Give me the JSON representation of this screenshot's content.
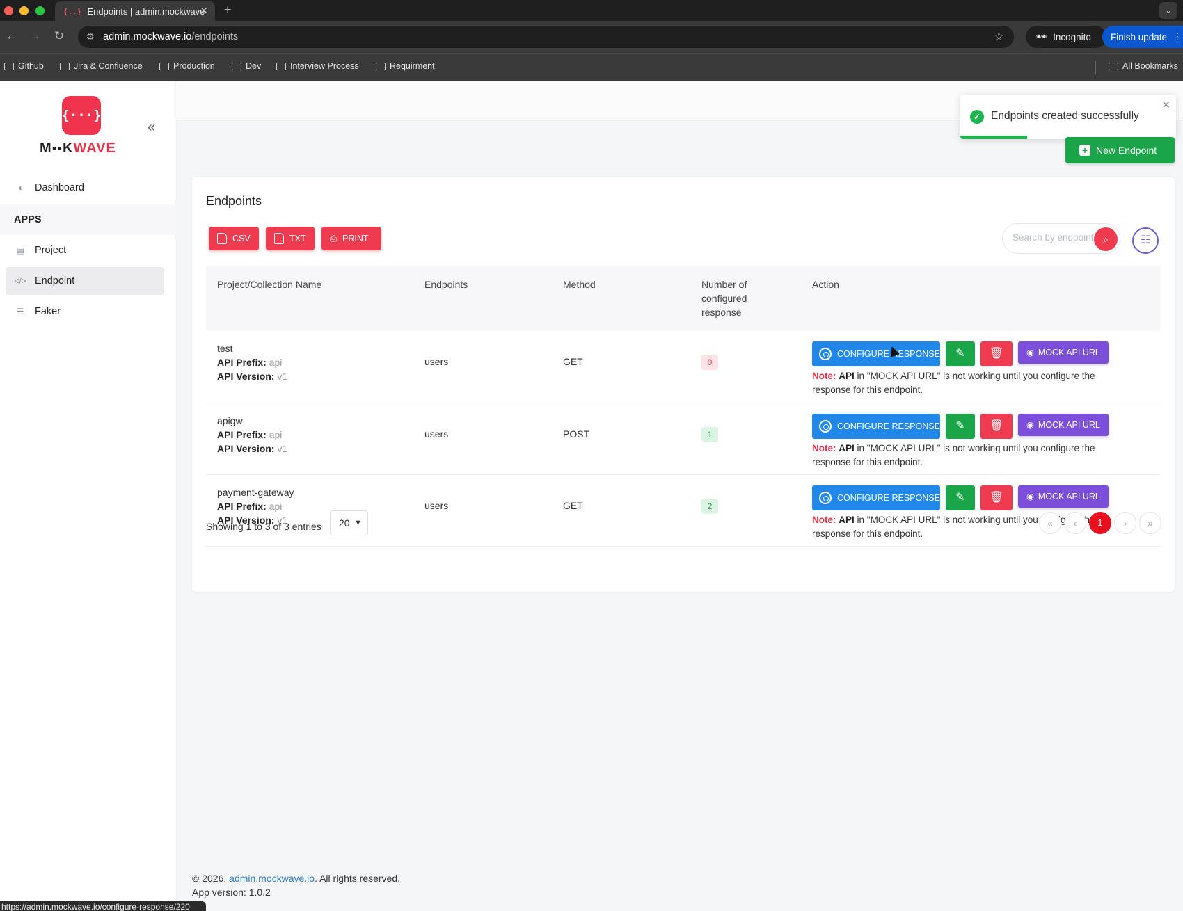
{
  "browser": {
    "tab_title": "Endpoints | admin.mockwave",
    "tab_favicon": "{..}",
    "url_host": "admin.mockwave.io",
    "url_path": "/endpoints",
    "incognito_label": "Incognito",
    "finish_update_label": "Finish update",
    "bookmarks": [
      "Github",
      "Jira & Confluence",
      "Production",
      "Dev",
      "Interview Process",
      "Requirment"
    ],
    "all_bookmarks_label": "All Bookmarks",
    "status_url": "https://admin.mockwave.io/configure-response/220"
  },
  "sidebar": {
    "logo_icon": "{···}",
    "logo_mo": "M",
    "logo_oo": "●●",
    "logo_k": "K",
    "logo_wave": "WAVE",
    "items": [
      {
        "label": "Dashboard",
        "icon": "dashboard-icon"
      },
      {
        "label": "Project",
        "icon": "project-icon"
      },
      {
        "label": "Endpoint",
        "icon": "code-icon"
      },
      {
        "label": "Faker",
        "icon": "faker-icon"
      }
    ],
    "section_label": "APPS"
  },
  "toast": {
    "message": "Endpoints created successfully"
  },
  "main": {
    "new_endpoint_label": "New Endpoint",
    "card_title": "Endpoints",
    "export": {
      "csv": "CSV",
      "txt": "TXT",
      "print": "PRINT"
    },
    "search_placeholder": "Search by endpoint",
    "columns": [
      "Project/Collection Name",
      "Endpoints",
      "Method",
      "Number of configured response",
      "Action"
    ],
    "prefix_label": "API Prefix:",
    "version_label": "API Version:",
    "rows": [
      {
        "name": "test",
        "prefix": "api",
        "version": "v1",
        "endpoint": "users",
        "method": "GET",
        "count": "0"
      },
      {
        "name": "apigw",
        "prefix": "api",
        "version": "v1",
        "endpoint": "users",
        "method": "POST",
        "count": "1"
      },
      {
        "name": "payment-gateway",
        "prefix": "api",
        "version": "v1",
        "endpoint": "users",
        "method": "GET",
        "count": "2"
      }
    ],
    "configure_label": "CONFIGURE RESPONSE",
    "mock_label": "MOCK API URL",
    "note_label": "Note:",
    "note_api": "API",
    "note_text": " in \"MOCK API URL\" is not working until you configure the response for this endpoint.",
    "showing_text": "Showing 1 to 3 of 3 entries",
    "page_size": "20",
    "current_page": "1"
  },
  "footer": {
    "copyright_prefix": "© 2026. ",
    "link": "admin.mockwave.io",
    "copyright_suffix": ". All rights reserved.",
    "version": "App version: 1.0.2"
  },
  "colors": {
    "brand_red": "#f0344d",
    "success_green": "#1ba549",
    "primary_blue": "#2187e8",
    "mock_purple": "#7b4fd9"
  }
}
